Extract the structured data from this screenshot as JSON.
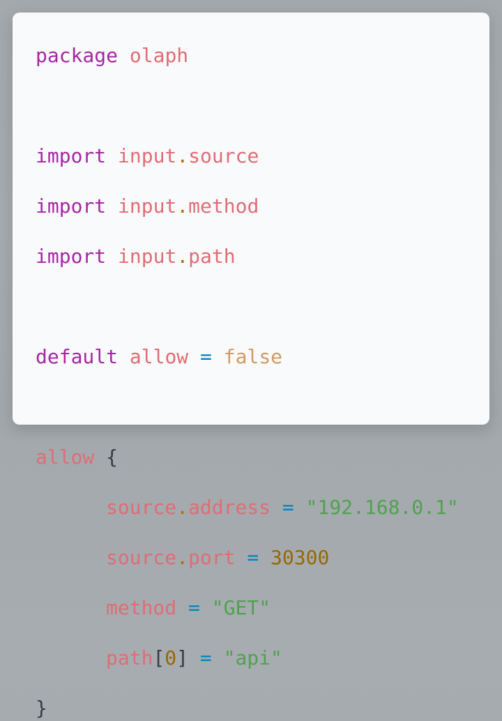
{
  "code": {
    "package_keyword": "package",
    "package_name": "olaph",
    "imports": [
      {
        "keyword": "import",
        "base": "input",
        "dot": ".",
        "member": "source"
      },
      {
        "keyword": "import",
        "base": "input",
        "dot": ".",
        "member": "method"
      },
      {
        "keyword": "import",
        "base": "input",
        "dot": ".",
        "member": "path"
      }
    ],
    "default_rule": {
      "keyword": "default",
      "name": "allow",
      "operator": "=",
      "value": "false"
    },
    "allow_rule": {
      "name": "allow",
      "open_brace": "{",
      "close_brace": "}",
      "conditions": [
        {
          "base": "source",
          "dot": ".",
          "member": "address",
          "operator": "=",
          "value": "\"192.168.0.1\""
        },
        {
          "base": "source",
          "dot": ".",
          "member": "port",
          "operator": "=",
          "value": "30300"
        },
        {
          "name": "method",
          "operator": "=",
          "value": "\"GET\""
        },
        {
          "name": "path",
          "open_bracket": "[",
          "index": "0",
          "close_bracket": "]",
          "operator": "=",
          "value": "\"api\""
        }
      ]
    }
  },
  "colors": {
    "keyword": "#a626a4",
    "variable": "#e06c75",
    "dot": "#b76b01",
    "operator": "#0184bc",
    "boolean": "#d19a66",
    "string": "#50a14f",
    "number": "#986801",
    "punctuation": "#383a42",
    "card_background": "#f9fafb"
  }
}
